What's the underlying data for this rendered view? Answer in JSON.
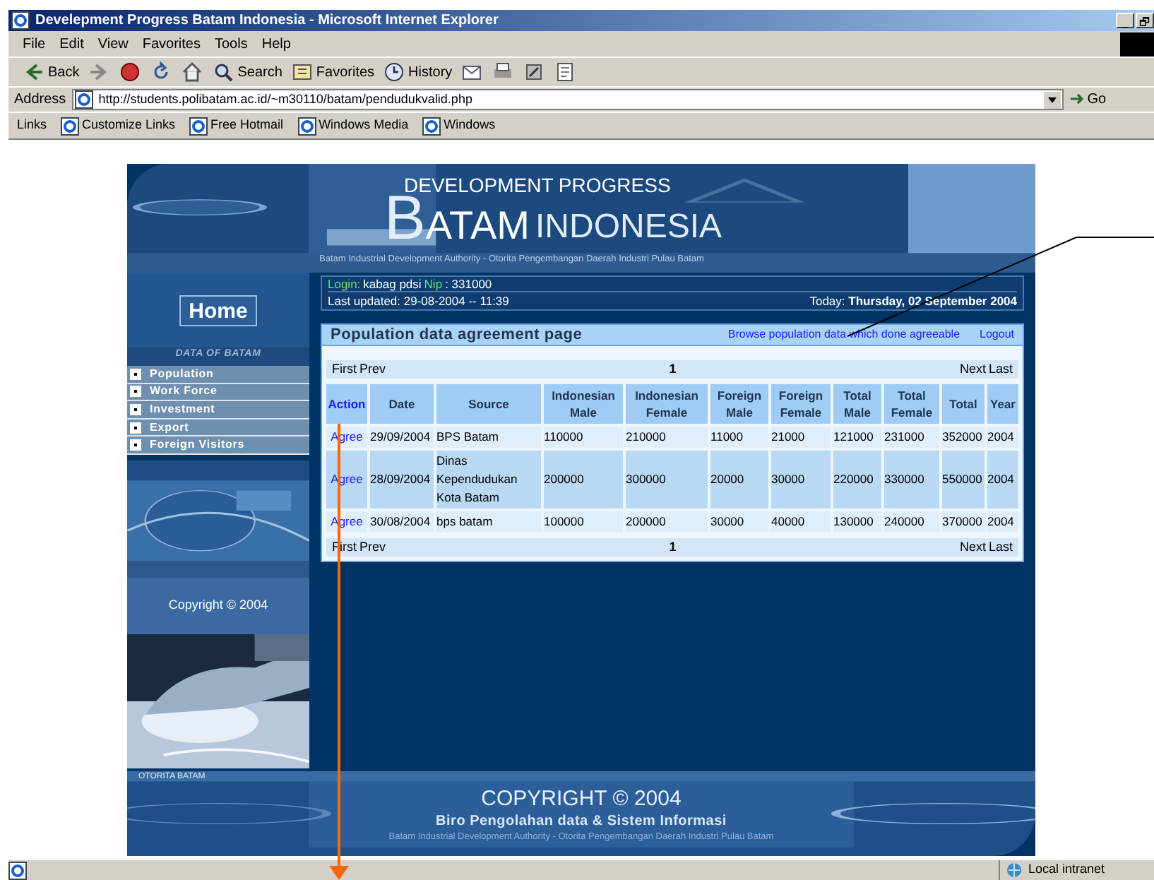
{
  "window": {
    "title": "Develepment Progress Batam Indonesia - Microsoft Internet Explorer",
    "controls": [
      "_",
      "🗗"
    ]
  },
  "menu": [
    "File",
    "Edit",
    "View",
    "Favorites",
    "Tools",
    "Help"
  ],
  "toolbar": [
    {
      "kind": "back",
      "label": "Back"
    },
    {
      "kind": "forward"
    },
    {
      "kind": "stop"
    },
    {
      "kind": "refresh"
    },
    {
      "kind": "home"
    },
    {
      "kind": "search",
      "label": "Search"
    },
    {
      "kind": "favorites",
      "label": "Favorites"
    },
    {
      "kind": "history",
      "label": "History"
    },
    {
      "kind": "mail"
    },
    {
      "kind": "print"
    },
    {
      "kind": "edit"
    },
    {
      "kind": "discuss"
    }
  ],
  "address": {
    "label": "Address",
    "url": "http://students.polibatam.ac.id/~m30110/batam/pendudukvalid.php",
    "go": "Go"
  },
  "links": {
    "label": "Links",
    "items": [
      "Customize Links",
      "Free Hotmail",
      "Windows Media",
      "Windows"
    ]
  },
  "site": {
    "header": {
      "line1": "DEVELOPMENT PROGRESS",
      "big_letter": "B",
      "line2": "ATAM",
      "line3": "INDONESIA",
      "subtitle": "Batam Industrial Development Authority - Otorita Pengembangan Daerah Industri Pulau Batam"
    },
    "home": "Home",
    "nav_title": "DATA OF BATAM",
    "nav": [
      "Population",
      "Work Force",
      "Investment",
      "Export",
      "Foreign Visitors"
    ],
    "copyright": "Copyright © 2004",
    "login": {
      "label": "Login:",
      "user": "kabag pdsi",
      "nip_label": "Nip",
      "nip": ": 331000",
      "updated": "Last updated: 29-08-2004 -- 11:39",
      "today": "Today: **Thursday, 02 September 2004**"
    },
    "panel": {
      "title": "Population data agreement page",
      "links": [
        "Browse population data which done agreeable",
        "Logout"
      ]
    },
    "pager_top": {
      "first": "First",
      "prev": "Prev",
      "page": "1",
      "next": "Next",
      "last": "Last"
    },
    "table": {
      "columns": [
        "Action",
        "Date",
        "Source",
        "Indonesian Male",
        "Indonesian Female",
        "Foreign Male",
        "Foreign Female",
        "Total Male",
        "Total Female",
        "Total",
        "Year"
      ],
      "rows": [
        [
          "Agree",
          "29/09/2004",
          "BPS Batam",
          "110000",
          "210000",
          "11000",
          "21000",
          "121000",
          "231000",
          "352000",
          "2004"
        ],
        [
          "Agree",
          "28/09/2004",
          "Dinas Kependudukan Kota Batam",
          "200000",
          "300000",
          "20000",
          "30000",
          "220000",
          "330000",
          "550000",
          "2004"
        ],
        [
          "Agree",
          "30/08/2004",
          "bps batam",
          "100000",
          "200000",
          "30000",
          "40000",
          "130000",
          "240000",
          "370000",
          "2004"
        ]
      ]
    },
    "pager_bottom": {
      "first": "First",
      "prev": "Prev",
      "page": "1",
      "next": "Next",
      "last": "Last"
    },
    "footer": {
      "tag": "OTORITA BATAM",
      "copyright": "COPYRIGHT © 2004",
      "unit": "Biro Pengolahan data & Sistem Informasi",
      "authority": "Batam Industrial Development Authority - Otorita Pengembangan Daerah Industri Pulau Batam"
    }
  },
  "status_bar": {
    "zone": "Local intranet"
  }
}
